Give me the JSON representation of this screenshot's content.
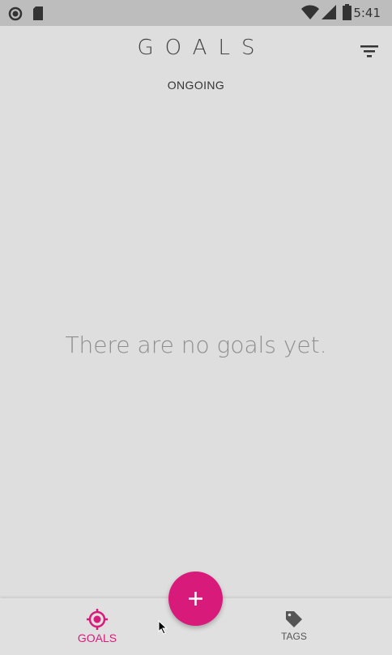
{
  "status_bar": {
    "time": "5:41",
    "icons": [
      "circle-icon",
      "sd-card-icon",
      "wifi-icon",
      "signal-icon",
      "battery-icon"
    ]
  },
  "header": {
    "title": "GOALS",
    "filter_icon": "filter-icon"
  },
  "section": {
    "label": "ONGOING"
  },
  "empty_state": {
    "message": "There are no goals yet."
  },
  "bottom_nav": {
    "items": [
      {
        "label": "GOALS",
        "icon": "target-icon",
        "active": true
      },
      {
        "label": "TAGS",
        "icon": "tag-icon",
        "active": false
      }
    ]
  },
  "fab": {
    "icon": "plus-icon"
  },
  "colors": {
    "accent": "#d81b7a",
    "background": "#dedede",
    "status_bar": "#bdbdbd",
    "empty_text": "#8e8e8e"
  }
}
